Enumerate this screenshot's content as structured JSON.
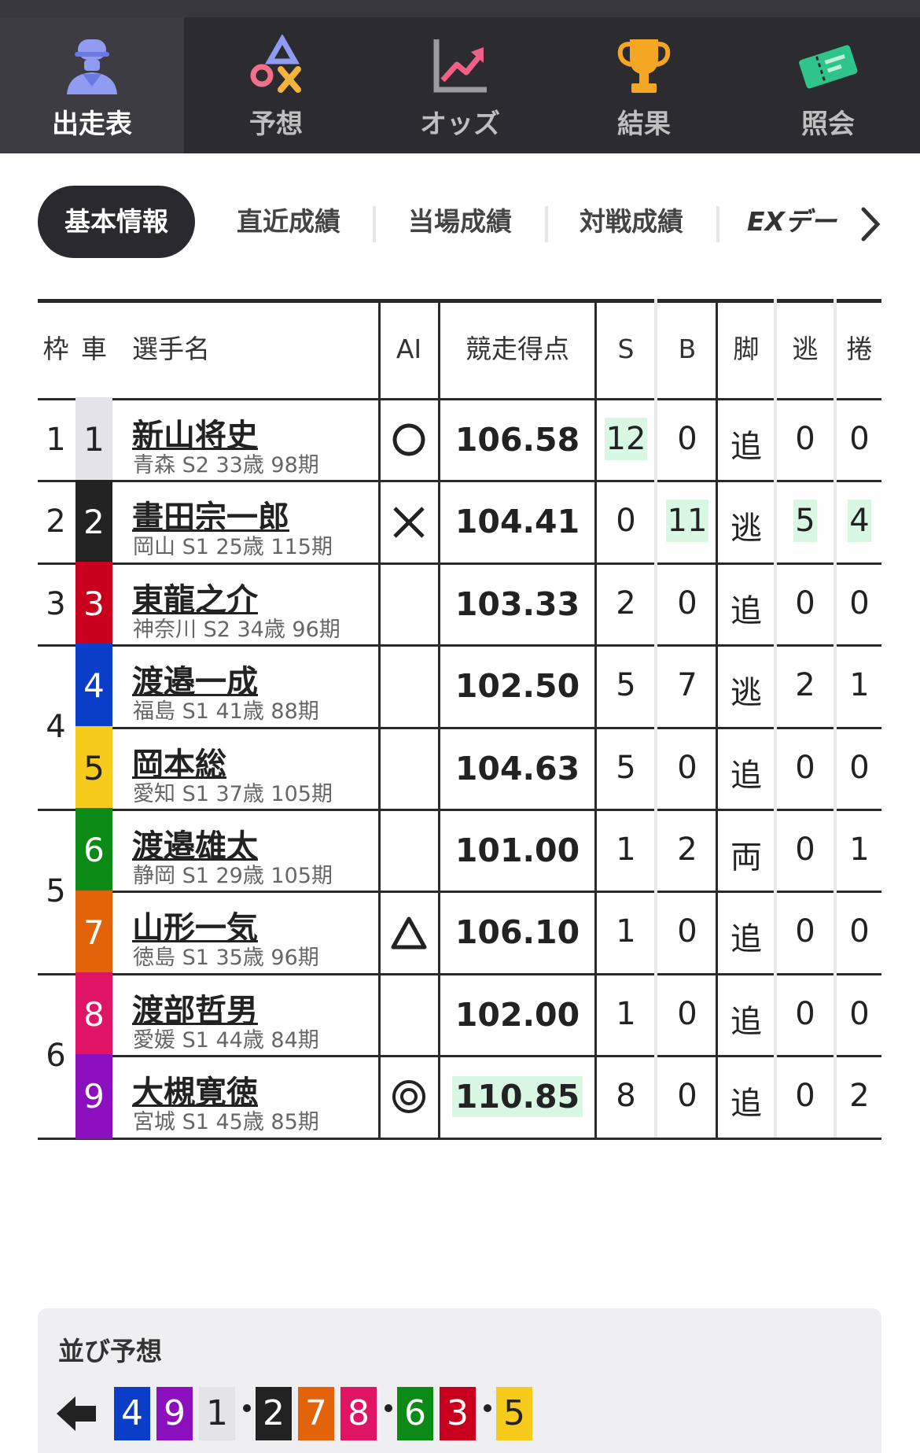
{
  "top_nav": {
    "items": [
      {
        "label": "出走表",
        "icon": "racer-icon",
        "active": true
      },
      {
        "label": "予想",
        "icon": "symbols-icon"
      },
      {
        "label": "オッズ",
        "icon": "odds-chart-icon"
      },
      {
        "label": "結果",
        "icon": "trophy-icon"
      },
      {
        "label": "照会",
        "icon": "ticket-icon"
      }
    ]
  },
  "tabs": [
    {
      "label": "基本情報",
      "active": true
    },
    {
      "label": "直近成績"
    },
    {
      "label": "当場成績"
    },
    {
      "label": "対戦成績"
    },
    {
      "label": "EXデー"
    }
  ],
  "table": {
    "headers": {
      "waku": "枠",
      "car": "車",
      "name": "選手名",
      "ai": "AI",
      "score": "競走得点",
      "s": "S",
      "b": "B",
      "leg": "脚",
      "nige": "逃",
      "makuri": "捲"
    },
    "rows": [
      {
        "waku": "1",
        "car": "1",
        "car_color": "#e4e4e8",
        "car_text": "#222222",
        "name": "新山将史",
        "info": "青森 S2 33歳 98期",
        "ai": "○",
        "score": "106.58",
        "s": "12",
        "b": "0",
        "leg": "追",
        "nige": "0",
        "makuri": "0"
      },
      {
        "waku": "2",
        "car": "2",
        "car_color": "#222222",
        "car_text": "#ffffff",
        "name": "畫田宗一郎",
        "info": "岡山 S1 25歳 115期",
        "ai": "×",
        "score": "104.41",
        "s": "0",
        "b": "11",
        "leg": "逃",
        "nige": "5",
        "makuri": "4"
      },
      {
        "waku": "3",
        "car": "3",
        "car_color": "#c8001e",
        "car_text": "#ffffff",
        "name": "東龍之介",
        "info": "神奈川 S2 34歳 96期",
        "ai": "",
        "score": "103.33",
        "s": "2",
        "b": "0",
        "leg": "追",
        "nige": "0",
        "makuri": "0"
      },
      {
        "waku": "4",
        "car": "4",
        "car_color": "#0a3ec8",
        "car_text": "#ffffff",
        "name": "渡邉一成",
        "info": "福島 S1 41歳 88期",
        "ai": "",
        "score": "102.50",
        "s": "5",
        "b": "7",
        "leg": "逃",
        "nige": "2",
        "makuri": "1"
      },
      {
        "waku": "",
        "car": "5",
        "car_color": "#f7cb1b",
        "car_text": "#222222",
        "name": "岡本総",
        "info": "愛知 S1 37歳 105期",
        "ai": "",
        "score": "104.63",
        "s": "5",
        "b": "0",
        "leg": "追",
        "nige": "0",
        "makuri": "0"
      },
      {
        "waku": "5",
        "car": "6",
        "car_color": "#0b8a16",
        "car_text": "#ffffff",
        "name": "渡邉雄太",
        "info": "静岡 S1 29歳 105期",
        "ai": "",
        "score": "101.00",
        "s": "1",
        "b": "2",
        "leg": "両",
        "nige": "0",
        "makuri": "1"
      },
      {
        "waku": "",
        "car": "7",
        "car_color": "#e3630a",
        "car_text": "#ffffff",
        "name": "山形一気",
        "info": "徳島 S1 35歳 96期",
        "ai": "△",
        "score": "106.10",
        "s": "1",
        "b": "0",
        "leg": "追",
        "nige": "0",
        "makuri": "0"
      },
      {
        "waku": "6",
        "car": "8",
        "car_color": "#e01464",
        "car_text": "#ffffff",
        "name": "渡部哲男",
        "info": "愛媛 S1 44歳 84期",
        "ai": "",
        "score": "102.00",
        "s": "1",
        "b": "0",
        "leg": "追",
        "nige": "0",
        "makuri": "0"
      },
      {
        "waku": "",
        "car": "9",
        "car_color": "#8c0fbe",
        "car_text": "#ffffff",
        "name": "大槻寛徳",
        "info": "宮城 S1 45歳 85期",
        "ai": "◎",
        "score": "110.85",
        "s": "8",
        "b": "0",
        "leg": "追",
        "nige": "0",
        "makuri": "2"
      }
    ]
  },
  "lineup": {
    "title": "並び予想",
    "direction_icon": "arrow-left-icon",
    "groups": [
      [
        "4",
        "9",
        "1"
      ],
      [
        "2",
        "7",
        "8"
      ],
      [
        "6",
        "3"
      ],
      [
        "5"
      ]
    ]
  },
  "highlight_color": "#d8f8e4"
}
